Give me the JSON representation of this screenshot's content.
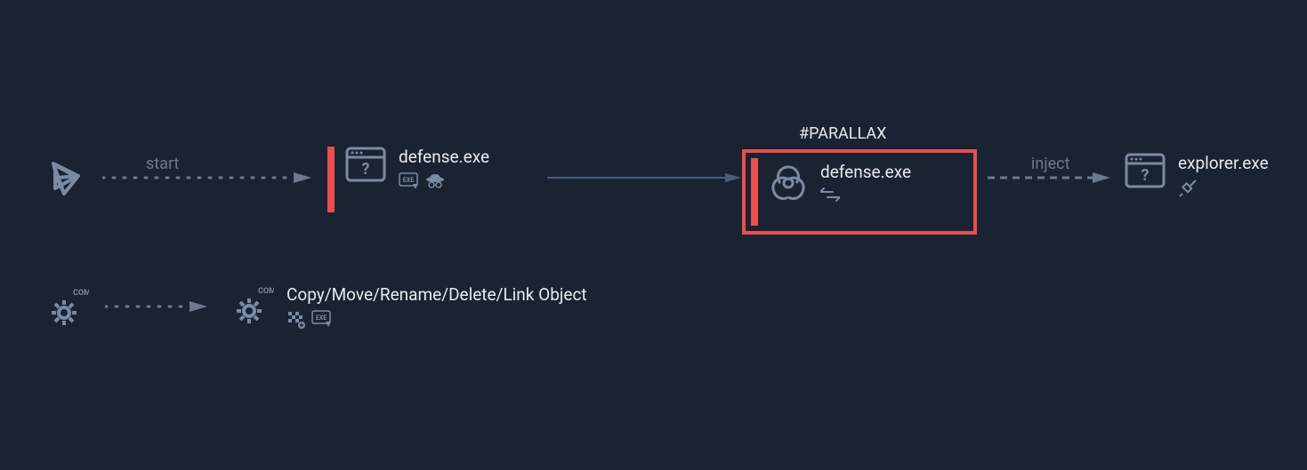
{
  "diagram": {
    "tag": "#PARALLAX",
    "nodes": {
      "start": {
        "label": ""
      },
      "defense1": {
        "label": "defense.exe"
      },
      "defense2": {
        "label": "defense.exe"
      },
      "explorer": {
        "label": "explorer.exe"
      },
      "com1": {
        "label": ""
      },
      "com2": {
        "label": "Copy/Move/Rename/Delete/Link Object"
      }
    },
    "edges": {
      "start_defense": {
        "label": "start"
      },
      "defense_defense": {
        "label": ""
      },
      "defense_explorer": {
        "label": "inject"
      },
      "com_com": {
        "label": ""
      }
    },
    "colors": {
      "bg": "#1a2332",
      "icon": "#7a8ba3",
      "text": "#e8eaed",
      "muted": "#6b7a8f",
      "accent": "#e94f4f",
      "line": "#4a5f7f"
    }
  }
}
